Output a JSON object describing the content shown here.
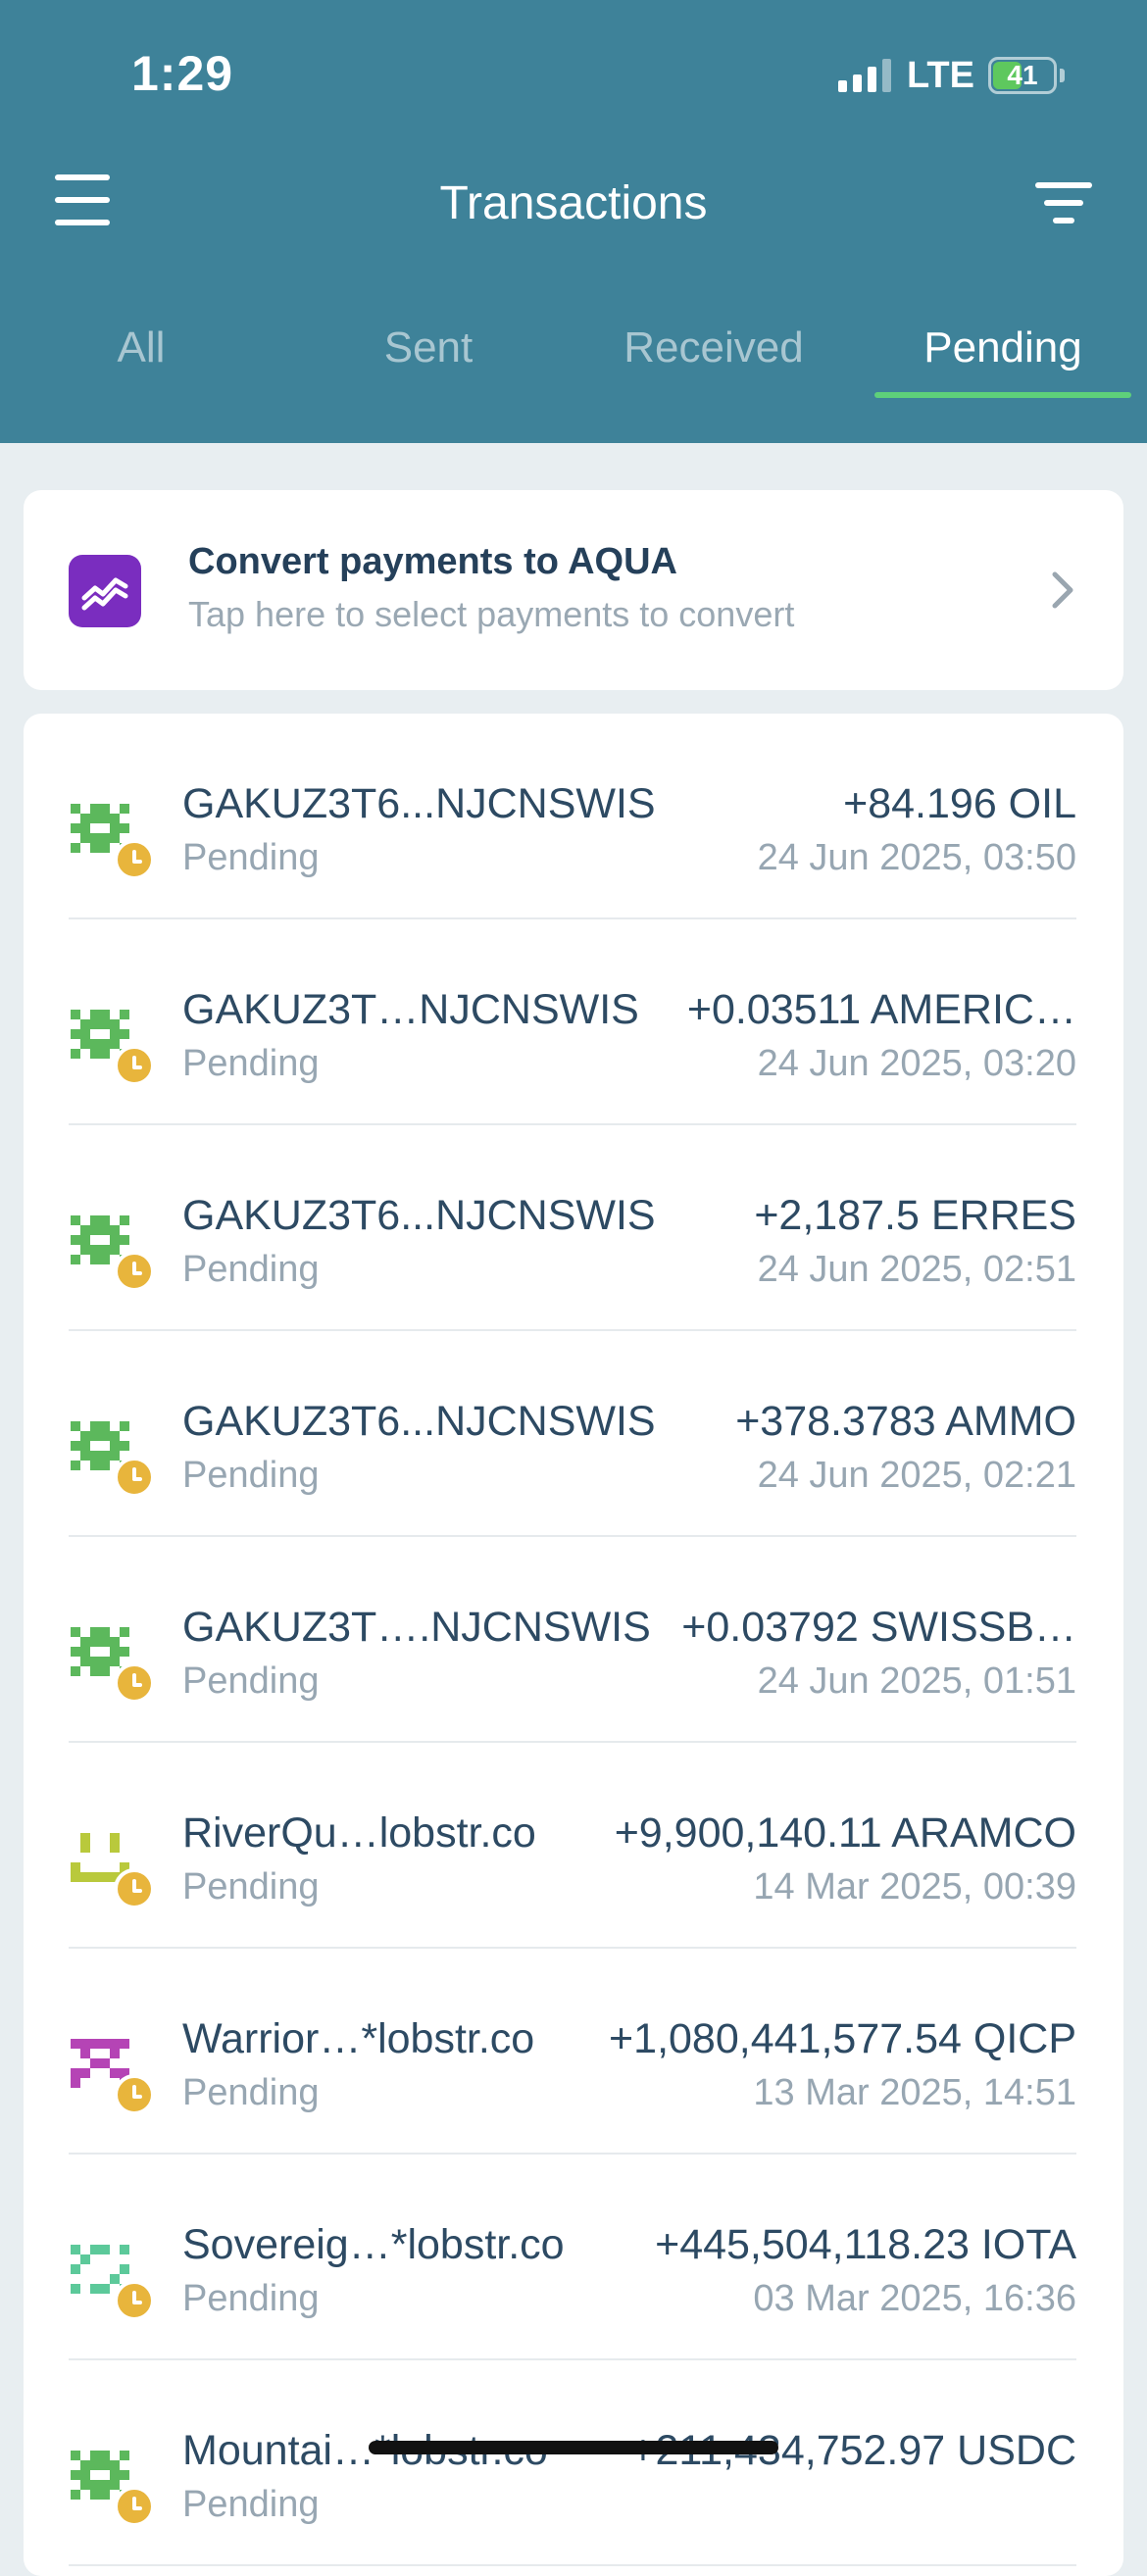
{
  "status_bar": {
    "time": "1:29",
    "network": "LTE",
    "battery": "41"
  },
  "header": {
    "title": "Transactions"
  },
  "tabs": [
    {
      "label": "All",
      "active": false
    },
    {
      "label": "Sent",
      "active": false
    },
    {
      "label": "Received",
      "active": false
    },
    {
      "label": "Pending",
      "active": true
    }
  ],
  "convert_card": {
    "title": "Convert payments to AQUA",
    "subtitle": "Tap here to select payments to convert"
  },
  "transactions": [
    {
      "address": "GAKUZ3T6...NJCNSWIS",
      "status": "Pending",
      "amount": "+84.196 OIL",
      "date": "24 Jun 2025, 03:50",
      "avatar_color": "#5cb85c"
    },
    {
      "address": "GAKUZ3T…NJCNSWIS",
      "status": "Pending",
      "amount": "+0.03511 AMERIC…",
      "date": "24 Jun 2025, 03:20",
      "avatar_color": "#5cb85c"
    },
    {
      "address": "GAKUZ3T6...NJCNSWIS",
      "status": "Pending",
      "amount": "+2,187.5 ERRES",
      "date": "24 Jun 2025, 02:51",
      "avatar_color": "#5cb85c"
    },
    {
      "address": "GAKUZ3T6...NJCNSWIS",
      "status": "Pending",
      "amount": "+378.3783 AMMO",
      "date": "24 Jun 2025, 02:21",
      "avatar_color": "#5cb85c"
    },
    {
      "address": "GAKUZ3T….NJCNSWIS",
      "status": "Pending",
      "amount": "+0.03792 SWISSB…",
      "date": "24 Jun 2025, 01:51",
      "avatar_color": "#5cb85c"
    },
    {
      "address": "RiverQu…lobstr.co",
      "status": "Pending",
      "amount": "+9,900,140.11 ARAMCO",
      "date": "14 Mar 2025, 00:39",
      "avatar_color": "#b9c93c"
    },
    {
      "address": "Warrior…*lobstr.co",
      "status": "Pending",
      "amount": "+1,080,441,577.54 QICP",
      "date": "13 Mar 2025, 14:51",
      "avatar_color": "#b544b5"
    },
    {
      "address": "Sovereig…*lobstr.co",
      "status": "Pending",
      "amount": "+445,504,118.23 IOTA",
      "date": "03 Mar 2025, 16:36",
      "avatar_color": "#5cc99a"
    },
    {
      "address": "Mountai…*lobstr.co",
      "status": "Pending",
      "amount": "+211,434,752.97 USDC",
      "date": "",
      "avatar_color": "#5cb85c"
    }
  ]
}
